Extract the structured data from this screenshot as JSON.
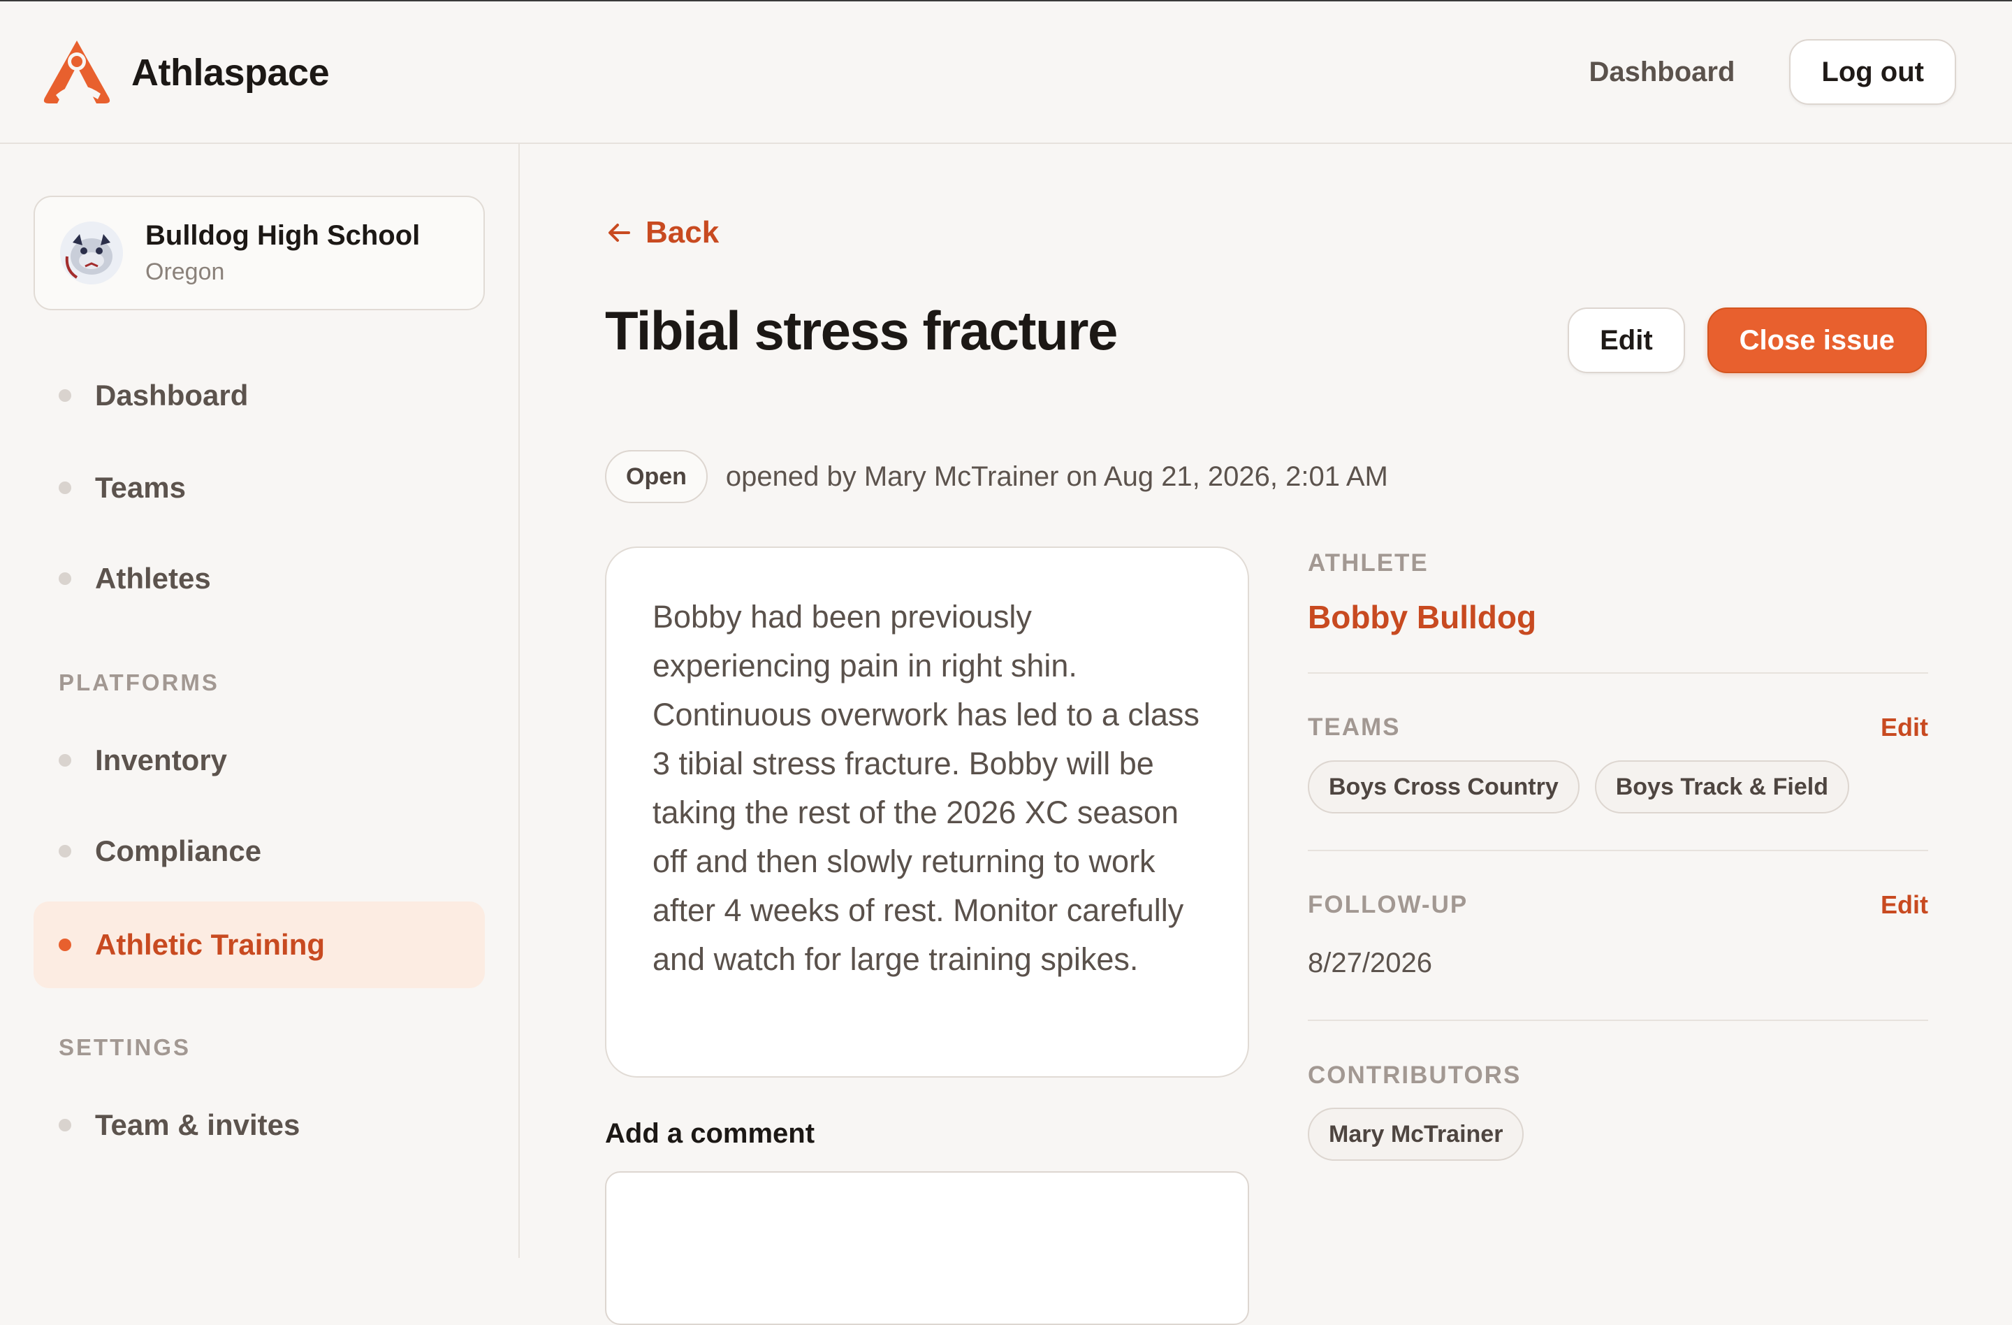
{
  "app": {
    "name": "Athlaspace",
    "brand_color": "#e8602e"
  },
  "header": {
    "dashboard_link": "Dashboard",
    "logout_label": "Log out"
  },
  "sidebar": {
    "org": {
      "name": "Bulldog High School",
      "location": "Oregon"
    },
    "items": [
      {
        "label": "Dashboard",
        "active": false
      },
      {
        "label": "Teams",
        "active": false
      },
      {
        "label": "Athletes",
        "active": false
      }
    ],
    "platforms_heading": "PLATFORMS",
    "platforms": [
      {
        "label": "Inventory",
        "active": false
      },
      {
        "label": "Compliance",
        "active": false
      },
      {
        "label": "Athletic Training",
        "active": true
      }
    ],
    "settings_heading": "SETTINGS",
    "settings": [
      {
        "label": "Team & invites",
        "active": false
      }
    ]
  },
  "issue": {
    "back_label": "Back",
    "title": "Tibial stress fracture",
    "edit_label": "Edit",
    "close_label": "Close issue",
    "status": "Open",
    "opened_text": "opened by Mary McTrainer on Aug 21, 2026, 2:01 AM",
    "description": "Bobby had been previously experiencing pain in right shin. Continuous overwork has led to a class 3 tibial stress fracture. Bobby will be taking the rest of the 2026 XC season off and then slowly returning to work after 4 weeks of rest. Monitor carefully and watch for large training spikes.",
    "comment_label": "Add a comment"
  },
  "details": {
    "athlete_heading": "ATHLETE",
    "athlete_name": "Bobby Bulldog",
    "teams_heading": "TEAMS",
    "teams_edit": "Edit",
    "teams": [
      "Boys Cross Country",
      "Boys Track & Field"
    ],
    "followup_heading": "FOLLOW-UP",
    "followup_edit": "Edit",
    "followup_date": "8/27/2026",
    "contributors_heading": "CONTRIBUTORS",
    "contributors": [
      "Mary McTrainer"
    ]
  }
}
